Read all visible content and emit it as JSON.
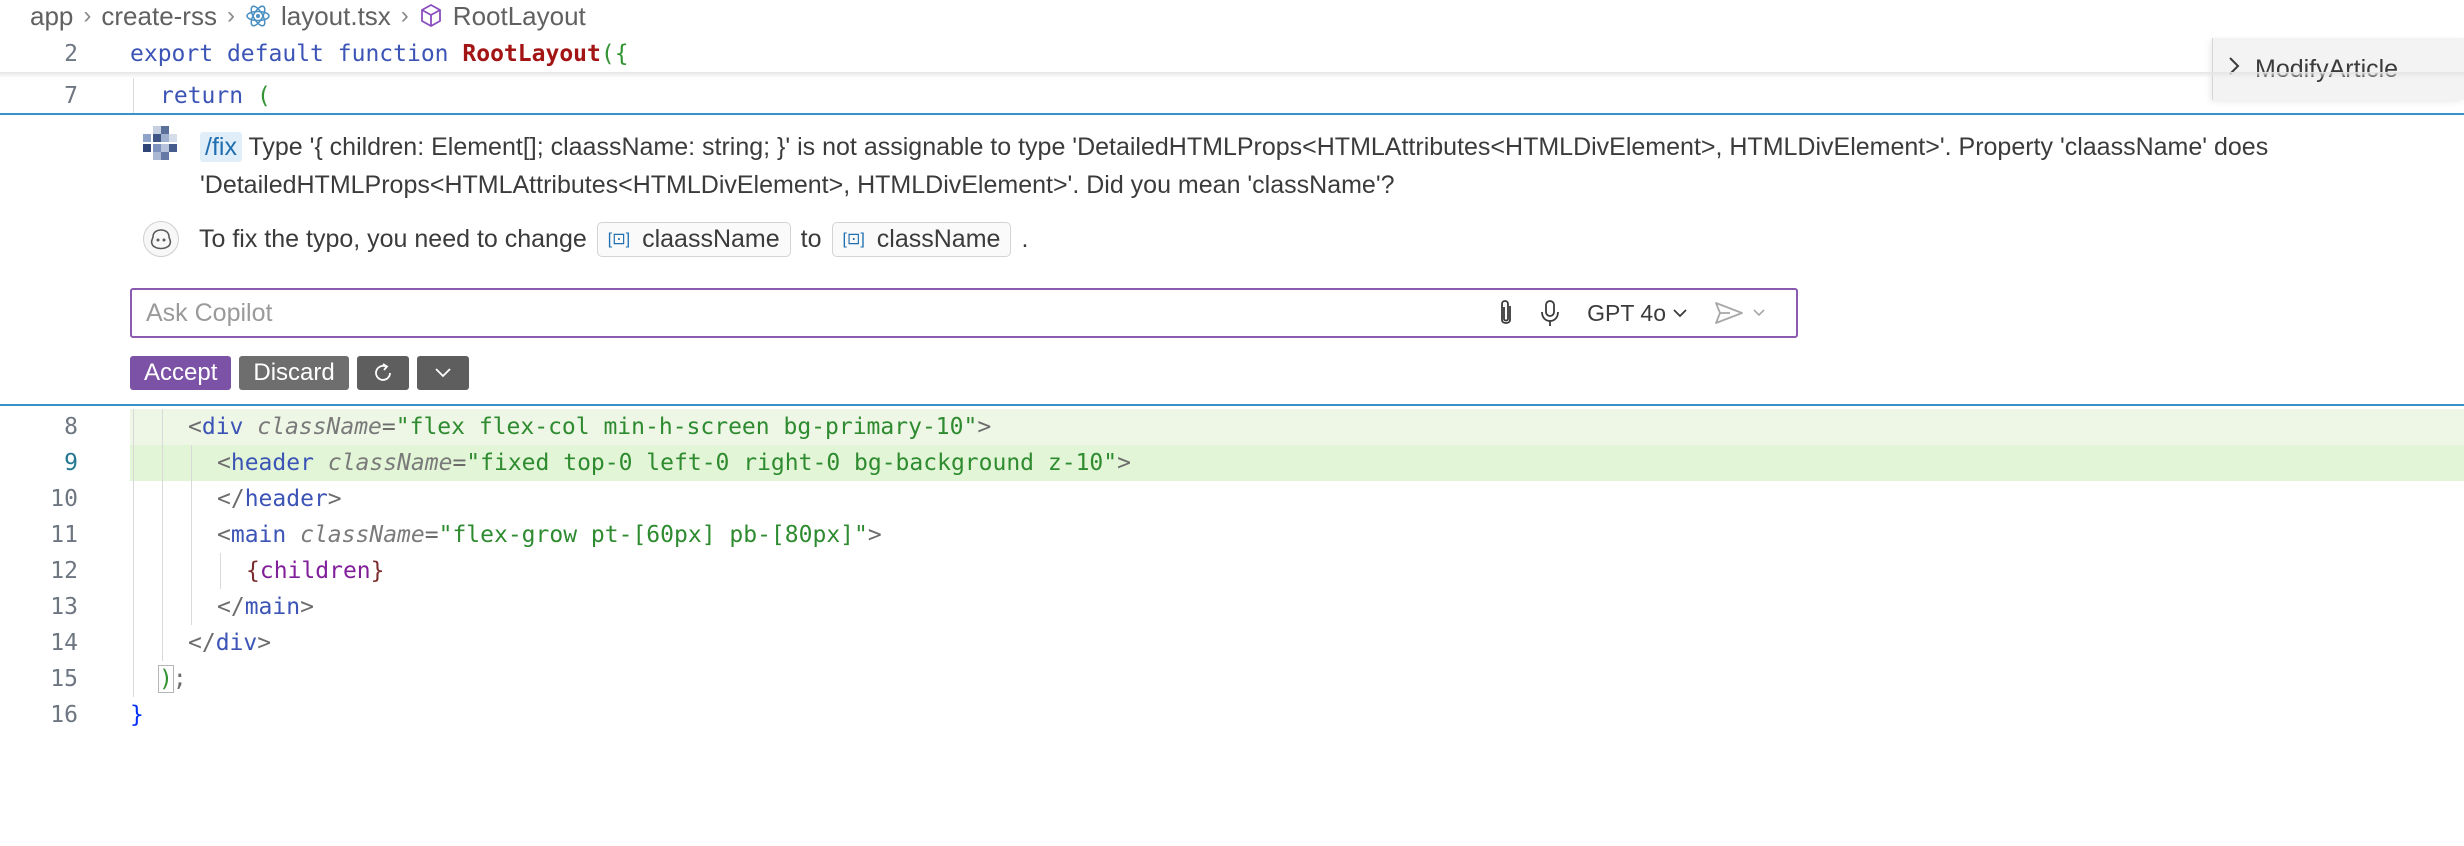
{
  "breadcrumb": {
    "items": [
      {
        "label": "app",
        "icon": ""
      },
      {
        "label": "create-rss",
        "icon": ""
      },
      {
        "label": "layout.tsx",
        "icon": "react-icon"
      },
      {
        "label": "RootLayout",
        "icon": "cube-icon"
      }
    ]
  },
  "outline": {
    "label": "ModifyArticle",
    "icon": "chevron-right-icon"
  },
  "sticky_lines": [
    {
      "number": "2"
    },
    {
      "number": "7"
    }
  ],
  "code_lines": [
    {
      "number": "8"
    },
    {
      "number": "9"
    },
    {
      "number": "10"
    },
    {
      "number": "11"
    },
    {
      "number": "12"
    },
    {
      "number": "13"
    },
    {
      "number": "14"
    },
    {
      "number": "15"
    },
    {
      "number": "16"
    }
  ],
  "code": {
    "l2": {
      "t1": "export",
      "t2": "default",
      "t3": "function",
      "t4": "RootLayout",
      "t5": "({"
    },
    "l7": {
      "t1": "return",
      "t2": "("
    },
    "l8": {
      "t1": "<",
      "t2": "div",
      "t3": "className",
      "t4": "=",
      "t5": "\"flex flex-col min-h-screen bg-primary-10\"",
      "t6": ">"
    },
    "l9": {
      "t1": "<",
      "t2": "header",
      "t3": "className",
      "t4": "=",
      "t5": "\"fixed top-0 left-0 right-0 bg-background z-10\"",
      "t6": ">"
    },
    "l10": {
      "t1": "</",
      "t2": "header",
      "t3": ">"
    },
    "l11": {
      "t1": "<",
      "t2": "main",
      "t3": "className",
      "t4": "=",
      "t5": "\"flex-grow pt-[60px] pb-[80px]\"",
      "t6": ">"
    },
    "l12": {
      "t1": "{",
      "t2": "children",
      "t3": "}"
    },
    "l13": {
      "t1": "</",
      "t2": "main",
      "t3": ">"
    },
    "l14": {
      "t1": "</",
      "t2": "div",
      "t3": ">"
    },
    "l15": {
      "t1": ")",
      "t2": ";"
    },
    "l16": {
      "t1": "}"
    }
  },
  "copilot": {
    "command": "/fix",
    "message_line1": " Type '{ children: Element[]; claassName: string; }' is not assignable to type 'DetailedHTMLProps<HTMLAttributes<HTMLDivElement>, HTMLDivElement>'. Property 'claassName' does",
    "message_line2": "'DetailedHTMLProps<HTMLAttributes<HTMLDivElement>, HTMLDivElement>'. Did you mean 'className'?",
    "reply_prefix": "To fix the typo, you need to change",
    "chip_from": "claassName",
    "reply_mid": "to",
    "chip_to": "className",
    "reply_suffix": ".",
    "ask_placeholder": "Ask Copilot",
    "model": "GPT 4o",
    "accept_label": "Accept",
    "discard_label": "Discard"
  },
  "colors": {
    "accent": "#7b52a6",
    "focus_border": "#8a5bb0",
    "diff_added": "#e2f5d6",
    "separator": "#3a93c8"
  }
}
